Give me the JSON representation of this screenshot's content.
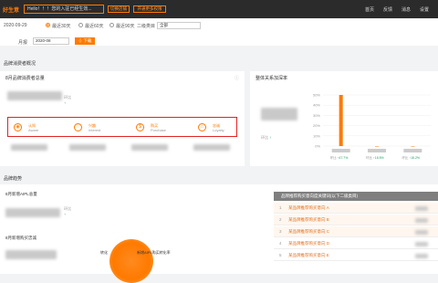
{
  "topbar": {
    "logo": "好生意",
    "hello": "Hello！！！您的入驻已经生效...",
    "btn_switch": "切换店铺",
    "btn_apply": "开通更多权限",
    "nav": [
      "首页",
      "反馈",
      "消息",
      "设置"
    ]
  },
  "filter": {
    "date": "2020-09-29",
    "radio": [
      "最近30天",
      "最近60天",
      "最近90天"
    ],
    "channel_label": "二级类目",
    "channel_value": "全部",
    "month_label": "月报",
    "month_value": "2020-08",
    "download": "下载"
  },
  "sections": {
    "overview": "品牌消费者概况",
    "card1_title": "8月品牌消费者总量",
    "card2_title": "整体关系加深率",
    "trend": "品牌趋势",
    "new_aipl": "8月新增AIPL总量",
    "new_purchase": "8月新增购买忠诚"
  },
  "stages": [
    {
      "cn": "认知",
      "en": "Aware",
      "icon": "eye-icon",
      "glyph": "◉"
    },
    {
      "cn": "兴趣",
      "en": "Interest",
      "icon": "heart-icon",
      "glyph": "♡"
    },
    {
      "cn": "购买",
      "en": "Purchase",
      "icon": "coin-icon",
      "glyph": "$"
    },
    {
      "cn": "忠诚",
      "en": "Loyalty",
      "icon": "star-icon",
      "glyph": "☆"
    }
  ],
  "huanbi": "环比",
  "pcts": [
    "47.7%",
    "15.5%",
    "15.2%"
  ],
  "chart_data": {
    "type": "bar",
    "categories": [
      "",
      "",
      ""
    ],
    "values": [
      50,
      0,
      0
    ],
    "ylim": [
      0,
      50
    ],
    "yticks": [
      "50%",
      "40%",
      "30%",
      "20%",
      "10%",
      "0%"
    ],
    "xlabel": "",
    "ylabel": "",
    "title": ""
  },
  "table": {
    "head": "品牌推荐购买意向度关键词(以下二级类目)",
    "rows": [
      {
        "no": "1",
        "name": "某品牌推荐购买意向 A"
      },
      {
        "no": "2",
        "name": "某品牌推荐购买意向 B"
      },
      {
        "no": "3",
        "name": "某品牌推荐购买意向 C"
      },
      {
        "no": "4",
        "name": "某品牌推荐购买意向 D"
      },
      {
        "no": "5",
        "name": "某品牌推荐购买意向 E"
      }
    ]
  },
  "funnel": {
    "left": "转化",
    "right": "新增AIPL购买转化率"
  },
  "accent": "#ff7a00"
}
